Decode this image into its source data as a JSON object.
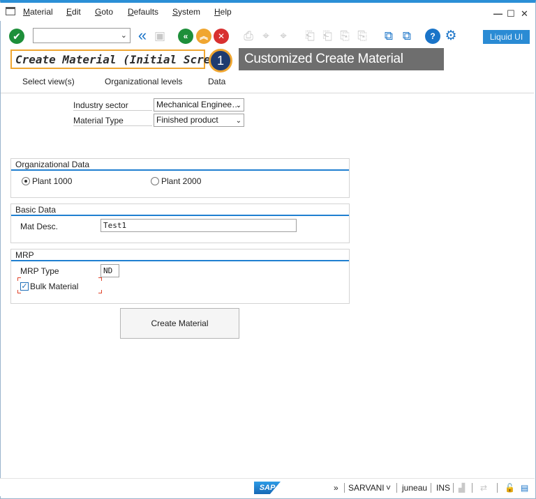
{
  "menu": [
    "Material",
    "Edit",
    "Goto",
    "Defaults",
    "System",
    "Help"
  ],
  "window_controls": {
    "minimize": "—",
    "maximize": "☐",
    "close": "✕"
  },
  "toolbar": {
    "ok_icon": "✔",
    "back_icon": "«",
    "liquid_ui": "Liquid UI",
    "help_icon": "?",
    "settings_icon": "⚙"
  },
  "title": {
    "text": "Create Material (Initial Screen)",
    "badge": "1",
    "callout": "Customized Create Material screen"
  },
  "app_toolbar": [
    "Select view(s)",
    "Organizational levels",
    "Data"
  ],
  "fields": {
    "industry_sector_label": "Industry sector",
    "industry_sector_value": "Mechanical Enginee…",
    "material_type_label": "Material Type",
    "material_type_value": "Finished product"
  },
  "org_data": {
    "header": "Organizational Data",
    "plant1": "Plant 1000",
    "plant2": "Plant 2000",
    "selected": "Plant 1000"
  },
  "basic_data": {
    "header": "Basic Data",
    "mat_desc_label": "Mat Desc.",
    "mat_desc_value": "Test1"
  },
  "mrp": {
    "header": "MRP",
    "mrp_type_label": "MRP Type",
    "mrp_type_value": "ND",
    "bulk_label": "Bulk Material",
    "bulk_checked": true
  },
  "create_button": "Create Material",
  "status": {
    "logo": "SAP",
    "more": "»",
    "user": "SARVANI",
    "user_arrow": "˅",
    "client": "juneau",
    "mode": "INS"
  },
  "colors": {
    "accent": "#2b8fd6",
    "highlight": "#f0a630",
    "badge": "#1f3b70",
    "callout": "#6e6e6e"
  }
}
